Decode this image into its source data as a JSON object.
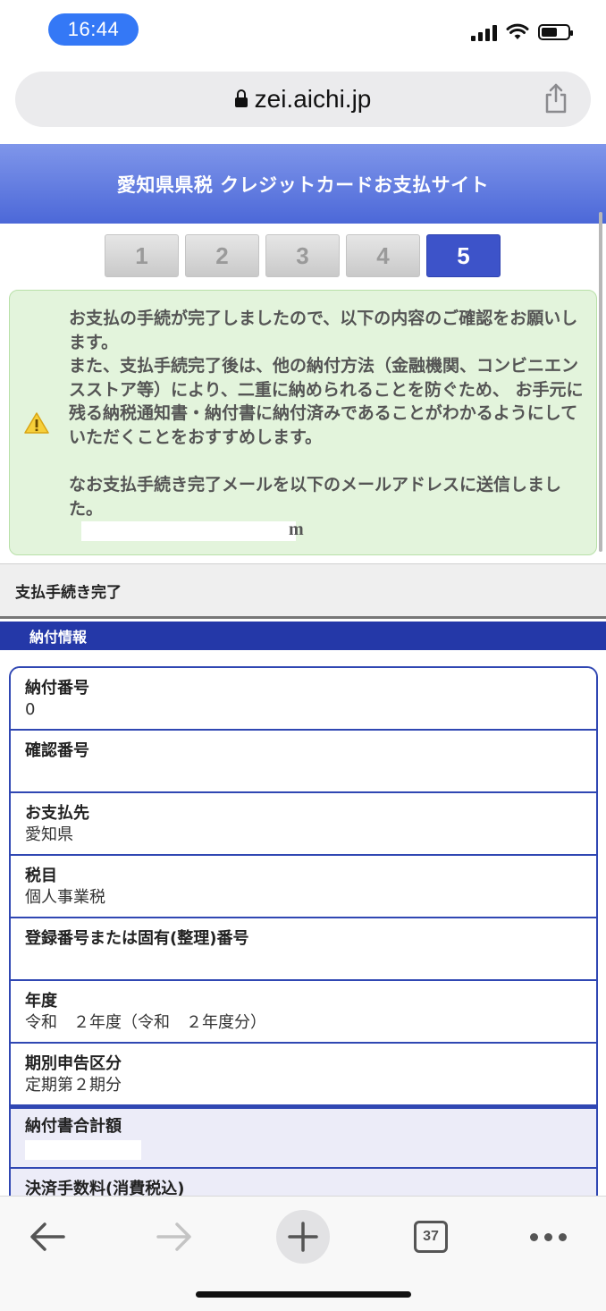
{
  "status_bar": {
    "time": "16:44"
  },
  "browser": {
    "url": "zei.aichi.jp",
    "tab_count": "37"
  },
  "site": {
    "title": "愛知県県税 クレジットカードお支払サイト"
  },
  "steps": {
    "s1": "1",
    "s2": "2",
    "s3": "3",
    "s4": "4",
    "s5": "5",
    "current": 5
  },
  "notice": {
    "para1": "お支払の手続が完了しましたので、以下の内容のご確認をお願いします。\nまた、支払手続完了後は、他の納付方法（金融機関、コンビニエンスストア等）により、二重に納められることを防ぐため、 お手元に残る納税通知書・納付書に納付済みであることがわかるようにしていただくことをおすすめします。",
    "para2": "なお支払手続き完了メールを以下のメールアドレスに送信しました。",
    "email_tail": "m"
  },
  "sections": {
    "complete": "支払手続き完了",
    "payment_info": "納付情報"
  },
  "rows": {
    "payment_no": {
      "label": "納付番号",
      "value": "0"
    },
    "confirm_no": {
      "label": "確認番号",
      "value": ""
    },
    "payee": {
      "label": "お支払先",
      "value": "愛知県"
    },
    "tax_item": {
      "label": "税目",
      "value": "個人事業税"
    },
    "reg_no": {
      "label": "登録番号または固有(整理)番号",
      "value": ""
    },
    "year": {
      "label": "年度",
      "value": "令和　２年度（令和　２年度分）"
    },
    "period": {
      "label": "期別申告区分",
      "value": "定期第２期分"
    },
    "total": {
      "label": "納付書合計額"
    },
    "fee": {
      "label": "決済手数料(消費税込)"
    }
  },
  "colors": {
    "header_blue": "#4c68d8",
    "step_active": "#3d53c9",
    "notice_bg": "#e3f4dc",
    "table_border": "#3047b3"
  }
}
